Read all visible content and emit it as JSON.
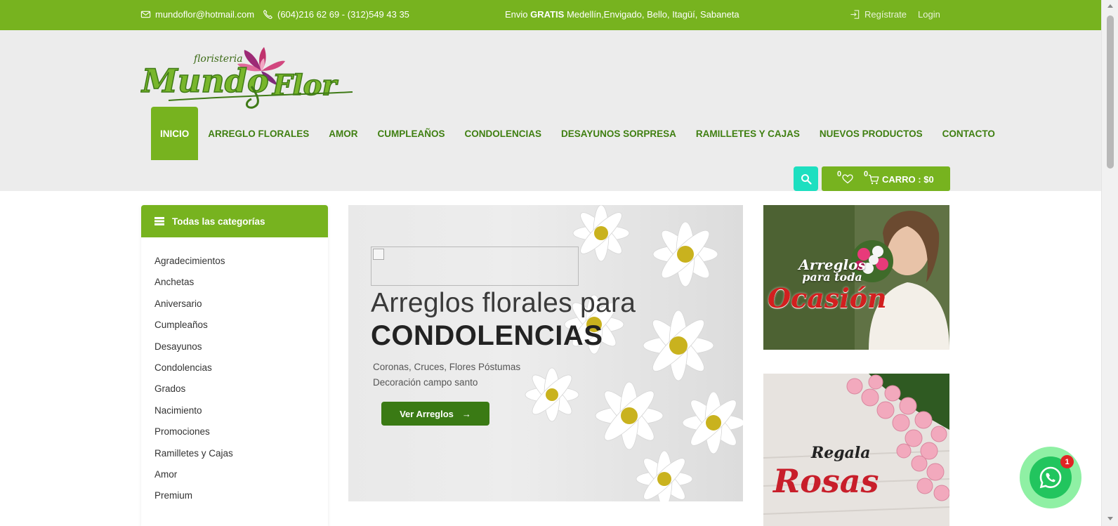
{
  "topbar": {
    "email": "mundoflor@hotmail.com",
    "phone": "(604)216 62 69 - (312)549 43 35",
    "shipping_prefix": "Envio",
    "shipping_bold": "GRATIS",
    "shipping_rest": "Medellín,Envigado, Bello, Itagüí, Sabaneta",
    "register": "Regístrate",
    "login": "Login",
    "icons": [
      "envelope-icon",
      "phone-icon",
      "login-icon"
    ]
  },
  "logo": {
    "small": "floristeria",
    "main": "Mundo",
    "main2": "Flor"
  },
  "nav": {
    "items": [
      {
        "label": "INICIO",
        "active": true
      },
      {
        "label": "ARREGLO FLORALES"
      },
      {
        "label": "AMOR"
      },
      {
        "label": "CUMPLEAÑOS"
      },
      {
        "label": "CONDOLENCIAS"
      },
      {
        "label": "DESAYUNOS SORPRESA"
      },
      {
        "label": "RAMILLETES Y CAJAS"
      },
      {
        "label": "NUEVOS PRODUCTOS"
      },
      {
        "label": "CONTACTO"
      }
    ]
  },
  "cart": {
    "wishlist_count": "0",
    "cart_count": "0",
    "label": "CARRO : $0"
  },
  "sidebar": {
    "title": "Todas las categorías",
    "categories": [
      "Agradecimientos",
      "Anchetas",
      "Aniversario",
      "Cumpleaños",
      "Desayunos",
      "Condolencias",
      "Grados",
      "Nacimiento",
      "Promociones",
      "Ramilletes y Cajas",
      "Amor",
      "Premium"
    ]
  },
  "hero": {
    "line1": "Arreglos florales para",
    "line2": "CONDOLENCIAS",
    "sub1": "Coronas, Cruces, Flores Póstumas",
    "sub2": "Decoración campo santo",
    "button": "Ver Arreglos",
    "button_arrow": "→"
  },
  "banners": {
    "first_line1": "Arreglos",
    "first_line2": "para toda",
    "first_line3": "Ocasión",
    "second_line1": "Regala",
    "second_line2": "Rosas"
  },
  "whatsapp": {
    "badge": "1"
  },
  "colors": {
    "brand_green": "#77b31f",
    "dark_green": "#3a7a14",
    "search_teal": "#1ddfc0",
    "whatsapp": "#22c55e"
  }
}
